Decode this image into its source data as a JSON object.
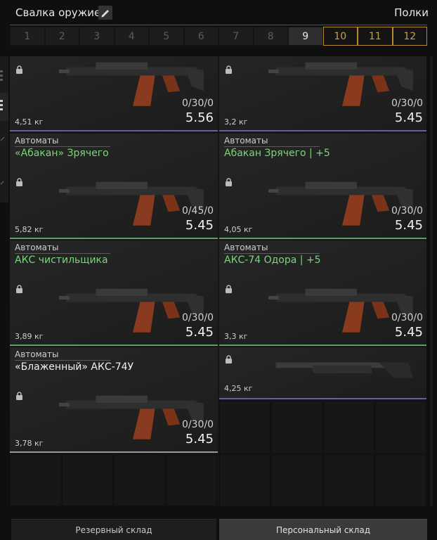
{
  "header": {
    "title": "Свалка оружие",
    "shelves_label": "Полки"
  },
  "tabs": [
    {
      "label": "1",
      "state": "normal"
    },
    {
      "label": "2",
      "state": "normal"
    },
    {
      "label": "3",
      "state": "normal"
    },
    {
      "label": "4",
      "state": "normal"
    },
    {
      "label": "5",
      "state": "normal"
    },
    {
      "label": "6",
      "state": "normal"
    },
    {
      "label": "7",
      "state": "normal"
    },
    {
      "label": "8",
      "state": "normal"
    },
    {
      "label": "9",
      "state": "active"
    },
    {
      "label": "10",
      "state": "gold"
    },
    {
      "label": "11",
      "state": "gold"
    },
    {
      "label": "12",
      "state": "gold"
    }
  ],
  "items": [
    {
      "category": "",
      "name": "",
      "ammo": "0/30/0",
      "price": "5.56",
      "weight": "4,51 кг",
      "name_color": "#7bd67b",
      "border": "purple"
    },
    {
      "category": "",
      "name": "",
      "ammo": "0/30/0",
      "price": "5.45",
      "weight": "3,2 кг",
      "name_color": "#7bd67b",
      "border": "purple"
    },
    {
      "category": "Автоматы",
      "name": "«Абакан» Зрячего",
      "ammo": "0/45/0",
      "price": "5.45",
      "weight": "5,82 кг",
      "name_color": "#7bd67b",
      "border": "green"
    },
    {
      "category": "Автоматы",
      "name": "Абакан Зрячего | +5",
      "ammo": "0/30/0",
      "price": "5.45",
      "weight": "4,05 кг",
      "name_color": "#7bd67b",
      "border": "green"
    },
    {
      "category": "Автоматы",
      "name": "АКС чистильщика",
      "ammo": "0/30/0",
      "price": "5.45",
      "weight": "3,89 кг",
      "name_color": "#7bd67b",
      "border": "green"
    },
    {
      "category": "Автоматы",
      "name": "АКС-74 Одора | +5",
      "ammo": "0/30/0",
      "price": "5.45",
      "weight": "3,3 кг",
      "name_color": "#7bd67b",
      "border": "green"
    },
    {
      "category": "Автоматы",
      "name": "«Блаженный» АКС-74У",
      "ammo": "0/30/0",
      "price": "5.45",
      "weight": "3,78 кг",
      "name_color": "#f0f0f0",
      "border": "white"
    },
    {
      "category": "",
      "name": "",
      "ammo": "",
      "price": "",
      "weight": "4,25 кг",
      "name_color": "#f0f0f0",
      "border": "purple"
    }
  ],
  "bottom": {
    "reserve_label": "Резервный склад",
    "personal_label": "Персональный склад"
  },
  "colors": {
    "gold": "#b58b2a",
    "green_name": "#7bd67b",
    "active_tab": "#2e2e2e"
  }
}
